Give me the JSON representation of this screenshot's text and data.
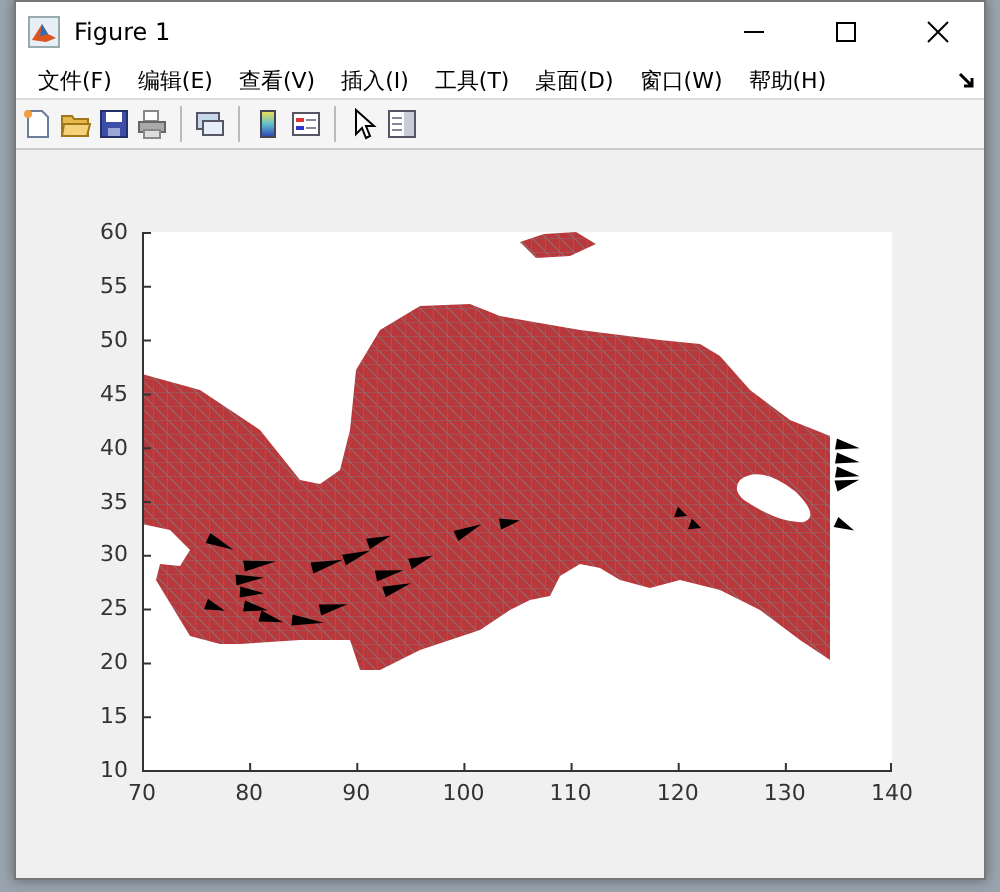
{
  "window": {
    "title": "Figure 1"
  },
  "menu": [
    "文件(F)",
    "编辑(E)",
    "查看(V)",
    "插入(I)",
    "工具(T)",
    "桌面(D)",
    "窗口(W)",
    "帮助(H)"
  ],
  "axes": {
    "yticks": [
      "60",
      "55",
      "50",
      "45",
      "40",
      "35",
      "30",
      "25",
      "20",
      "15",
      "10"
    ],
    "xticks": [
      "70",
      "80",
      "90",
      "100",
      "110",
      "120",
      "130",
      "140"
    ]
  }
}
